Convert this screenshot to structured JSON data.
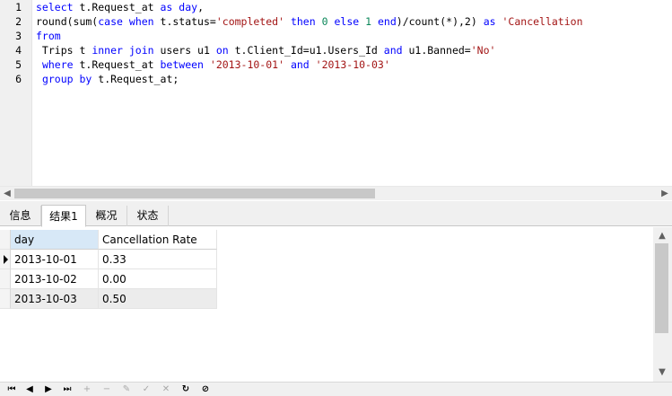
{
  "editor": {
    "line_numbers": [
      "1",
      "2",
      "3",
      "4",
      "5",
      "6"
    ],
    "lines": [
      [
        {
          "t": "select",
          "c": "kw"
        },
        {
          "t": " t.Request_at "
        },
        {
          "t": "as",
          "c": "kw"
        },
        {
          "t": " "
        },
        {
          "t": "day",
          "c": "kw"
        },
        {
          "t": ","
        }
      ],
      [
        {
          "t": "round(sum("
        },
        {
          "t": "case",
          "c": "kw"
        },
        {
          "t": " "
        },
        {
          "t": "when",
          "c": "kw"
        },
        {
          "t": " t.status="
        },
        {
          "t": "'completed'",
          "c": "str"
        },
        {
          "t": " "
        },
        {
          "t": "then",
          "c": "kw"
        },
        {
          "t": " "
        },
        {
          "t": "0",
          "c": "num"
        },
        {
          "t": " "
        },
        {
          "t": "else",
          "c": "kw"
        },
        {
          "t": " "
        },
        {
          "t": "1",
          "c": "num"
        },
        {
          "t": " "
        },
        {
          "t": "end",
          "c": "kw"
        },
        {
          "t": ")/count(*),2) "
        },
        {
          "t": "as",
          "c": "kw"
        },
        {
          "t": " "
        },
        {
          "t": "'Cancellation",
          "c": "str"
        }
      ],
      [
        {
          "t": "from",
          "c": "kw"
        }
      ],
      [
        {
          "t": " Trips t "
        },
        {
          "t": "inner",
          "c": "kw"
        },
        {
          "t": " "
        },
        {
          "t": "join",
          "c": "kw"
        },
        {
          "t": " users u1 "
        },
        {
          "t": "on",
          "c": "kw"
        },
        {
          "t": " t.Client_Id=u1.Users_Id "
        },
        {
          "t": "and",
          "c": "kw"
        },
        {
          "t": " u1.Banned="
        },
        {
          "t": "'No'",
          "c": "str"
        }
      ],
      [
        {
          "t": " "
        },
        {
          "t": "where",
          "c": "kw"
        },
        {
          "t": " t.Request_at "
        },
        {
          "t": "between",
          "c": "kw"
        },
        {
          "t": " "
        },
        {
          "t": "'2013-10-01'",
          "c": "str"
        },
        {
          "t": " "
        },
        {
          "t": "and",
          "c": "kw"
        },
        {
          "t": " "
        },
        {
          "t": "'2013-10-03'",
          "c": "str"
        }
      ],
      [
        {
          "t": " "
        },
        {
          "t": "group",
          "c": "kw"
        },
        {
          "t": " "
        },
        {
          "t": "by",
          "c": "kw"
        },
        {
          "t": " t.Request_at;"
        }
      ]
    ]
  },
  "tabs": [
    {
      "id": "info",
      "label": "信息",
      "active": false
    },
    {
      "id": "result1",
      "label": "结果1",
      "active": true
    },
    {
      "id": "overview",
      "label": "概况",
      "active": false
    },
    {
      "id": "status",
      "label": "状态",
      "active": false
    }
  ],
  "grid": {
    "columns": [
      "day",
      "Cancellation Rate"
    ],
    "rows": [
      [
        "2013-10-01",
        "0.33"
      ],
      [
        "2013-10-02",
        "0.00"
      ],
      [
        "2013-10-03",
        "0.50"
      ]
    ],
    "current_row": 0
  },
  "icons": {
    "hscroll_left": "◀",
    "hscroll_right": "▶",
    "vscroll_up": "▲",
    "vscroll_down": "▼",
    "nav_first": "⏮",
    "nav_prev": "◀",
    "nav_next": "▶",
    "nav_last": "⏭",
    "nav_add": "+",
    "nav_delete": "−",
    "nav_edit": "✎",
    "nav_apply": "✓",
    "nav_discard": "✕",
    "nav_refresh": "↻",
    "nav_stop": "⊘"
  }
}
